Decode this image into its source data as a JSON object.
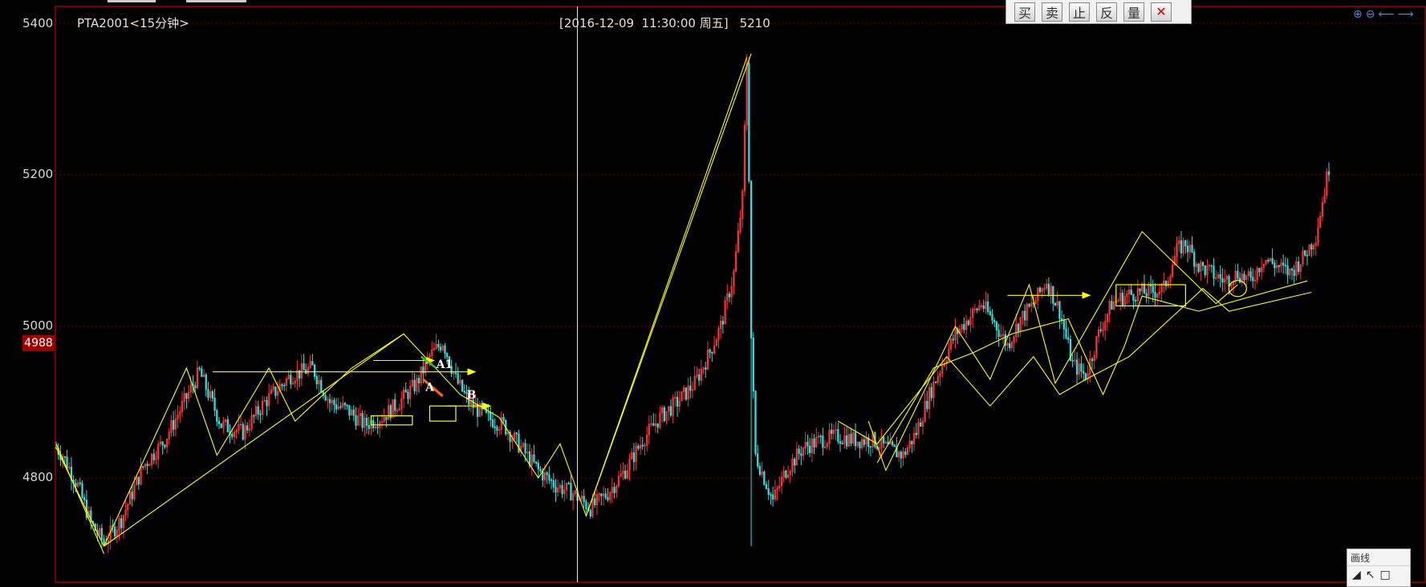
{
  "chart_header": {
    "title": "PTA2001<15分钟>",
    "cursor_datetime": "[2016-12-09  11:30:00 周五]",
    "cursor_value": "5210"
  },
  "current_price_label": "4988",
  "toolbar": {
    "buttons": [
      "买",
      "卖",
      "止",
      "反",
      "量"
    ],
    "close": "✕"
  },
  "zoom_tools": [
    "⊕",
    "⊖",
    "⟵",
    "⟶"
  ],
  "draw_panel": {
    "title": "画线",
    "icons": [
      "◢",
      "↖",
      "□"
    ]
  },
  "annotation_labels": {
    "a1": "A1",
    "a": "A",
    "b": "B"
  },
  "colors": {
    "background": "#000000",
    "up": "#ff3333",
    "down": "#33dddd",
    "annotation": "#ffff00",
    "grid": "#7a0000",
    "cursor": "#ffff66"
  },
  "chart_data": {
    "type": "candlestick",
    "title": "PTA2001<15分钟>",
    "y_ticks": [
      4800,
      5000,
      5200,
      5400
    ],
    "ylim": [
      4680,
      5420
    ],
    "grid": "horizontal dotted",
    "last_price": 4988,
    "price_path": [
      [
        0,
        4840
      ],
      [
        3,
        4830
      ],
      [
        10,
        4790
      ],
      [
        16,
        4740
      ],
      [
        22,
        4715
      ],
      [
        30,
        4745
      ],
      [
        40,
        4815
      ],
      [
        50,
        4850
      ],
      [
        58,
        4895
      ],
      [
        66,
        4940
      ],
      [
        76,
        4870
      ],
      [
        86,
        4860
      ],
      [
        96,
        4900
      ],
      [
        108,
        4935
      ],
      [
        118,
        4945
      ],
      [
        126,
        4900
      ],
      [
        134,
        4890
      ],
      [
        142,
        4870
      ],
      [
        150,
        4880
      ],
      [
        158,
        4900
      ],
      [
        166,
        4925
      ],
      [
        172,
        4960
      ],
      [
        178,
        4980
      ],
      [
        184,
        4930
      ],
      [
        190,
        4900
      ],
      [
        198,
        4880
      ],
      [
        206,
        4870
      ],
      [
        214,
        4840
      ],
      [
        222,
        4810
      ],
      [
        230,
        4790
      ],
      [
        238,
        4780
      ],
      [
        246,
        4760
      ],
      [
        254,
        4780
      ],
      [
        262,
        4810
      ],
      [
        270,
        4850
      ],
      [
        278,
        4880
      ],
      [
        286,
        4900
      ],
      [
        294,
        4925
      ],
      [
        300,
        4960
      ],
      [
        306,
        5000
      ],
      [
        312,
        5070
      ],
      [
        316,
        5170
      ],
      [
        318,
        5350
      ],
      [
        319,
        5200
      ],
      [
        320,
        4985
      ],
      [
        322,
        4830
      ],
      [
        326,
        4800
      ],
      [
        330,
        4770
      ],
      [
        336,
        4810
      ],
      [
        344,
        4840
      ],
      [
        352,
        4850
      ],
      [
        360,
        4855
      ],
      [
        368,
        4850
      ],
      [
        376,
        4850
      ],
      [
        382,
        4840
      ],
      [
        390,
        4830
      ],
      [
        396,
        4860
      ],
      [
        402,
        4910
      ],
      [
        408,
        4950
      ],
      [
        414,
        4990
      ],
      [
        420,
        5010
      ],
      [
        426,
        5030
      ],
      [
        432,
        5005
      ],
      [
        438,
        4975
      ],
      [
        444,
        5010
      ],
      [
        450,
        5030
      ],
      [
        456,
        5060
      ],
      [
        462,
        5020
      ],
      [
        468,
        4950
      ],
      [
        474,
        4935
      ],
      [
        480,
        4990
      ],
      [
        486,
        5030
      ],
      [
        492,
        5040
      ],
      [
        498,
        5045
      ],
      [
        504,
        5045
      ],
      [
        510,
        5050
      ],
      [
        516,
        5100
      ],
      [
        520,
        5110
      ],
      [
        526,
        5080
      ],
      [
        532,
        5070
      ],
      [
        538,
        5060
      ],
      [
        544,
        5070
      ],
      [
        550,
        5060
      ],
      [
        556,
        5090
      ],
      [
        562,
        5080
      ],
      [
        568,
        5070
      ],
      [
        574,
        5090
      ],
      [
        580,
        5120
      ],
      [
        584,
        5180
      ],
      [
        586,
        5210
      ]
    ],
    "spike_low": {
      "x": 320,
      "low": 4710
    },
    "spike_high": {
      "x": 319,
      "high": 5355
    },
    "cursor_x": 240,
    "annotations": [
      {
        "type": "zigzag",
        "points": [
          [
            0,
            4840
          ],
          [
            22,
            4710
          ],
          [
            60,
            4945
          ],
          [
            74,
            4830
          ],
          [
            98,
            4945
          ],
          [
            110,
            4875
          ],
          [
            136,
            4945
          ],
          [
            160,
            4990
          ],
          [
            186,
            4910
          ],
          [
            204,
            4880
          ],
          [
            222,
            4800
          ],
          [
            232,
            4845
          ],
          [
            244,
            4750
          ],
          [
            318,
            5355
          ]
        ]
      },
      {
        "type": "line",
        "points": [
          [
            22,
            4710
          ],
          [
            160,
            4990
          ]
        ]
      },
      {
        "type": "line",
        "points": [
          [
            0,
            4845
          ],
          [
            22,
            4700
          ]
        ]
      },
      {
        "type": "line",
        "points": [
          [
            244,
            4750
          ],
          [
            320,
            5360
          ]
        ]
      },
      {
        "type": "zigzag",
        "points": [
          [
            360,
            4875
          ],
          [
            378,
            4845
          ],
          [
            410,
            4960
          ],
          [
            430,
            4895
          ],
          [
            450,
            4960
          ],
          [
            462,
            4910
          ],
          [
            474,
            4930
          ],
          [
            494,
            4960
          ],
          [
            528,
            5050
          ],
          [
            540,
            5020
          ],
          [
            578,
            5045
          ]
        ]
      },
      {
        "type": "zigzag",
        "points": [
          [
            378,
            4820
          ],
          [
            404,
            4945
          ],
          [
            422,
            4965
          ],
          [
            440,
            4990
          ],
          [
            466,
            5010
          ],
          [
            482,
            4910
          ],
          [
            492,
            4975
          ],
          [
            500,
            5040
          ],
          [
            526,
            5020
          ],
          [
            576,
            5060
          ]
        ]
      },
      {
        "type": "zigzag",
        "points": [
          [
            374,
            4875
          ],
          [
            382,
            4810
          ],
          [
            414,
            5000
          ],
          [
            430,
            4930
          ],
          [
            448,
            5055
          ],
          [
            460,
            4925
          ],
          [
            500,
            5125
          ],
          [
            534,
            5030
          ],
          [
            544,
            5055
          ]
        ]
      },
      {
        "type": "arrow",
        "points": [
          [
            72,
            4940
          ],
          [
            193,
            4940
          ]
        ]
      },
      {
        "type": "arrow",
        "points": [
          [
            146,
            4955
          ],
          [
            174,
            4955
          ]
        ]
      },
      {
        "type": "arrow",
        "points": [
          [
            180,
            4895
          ],
          [
            200,
            4895
          ]
        ]
      },
      {
        "type": "arrow",
        "points": [
          [
            438,
            5041
          ],
          [
            476,
            5041
          ]
        ]
      },
      {
        "type": "box",
        "x0": 145,
        "x1": 164,
        "y0": 4870,
        "y1": 4882
      },
      {
        "type": "box",
        "x0": 172,
        "x1": 184,
        "y0": 4875,
        "y1": 4895
      },
      {
        "type": "box",
        "x0": 488,
        "x1": 520,
        "y0": 5027,
        "y1": 5055
      }
    ]
  }
}
